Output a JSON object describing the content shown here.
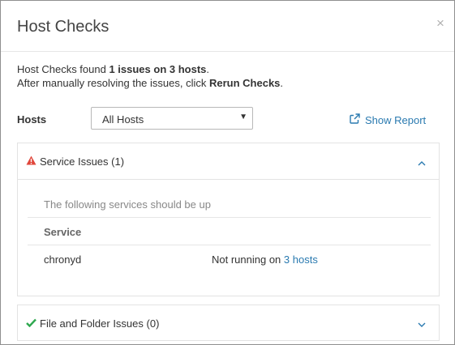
{
  "dialog": {
    "title": "Host Checks",
    "close_glyph": "×"
  },
  "summary": {
    "line1_prefix": "Host Checks found ",
    "line1_bold": "1 issues on 3 hosts",
    "line1_suffix": ".",
    "line2_prefix": "After manually resolving the issues, click ",
    "line2_bold": "Rerun Checks",
    "line2_suffix": "."
  },
  "hosts_filter": {
    "label": "Hosts",
    "selected": "All Hosts",
    "arrow_glyph": "▼"
  },
  "show_report": {
    "label": "Show Report",
    "icon": "external-link-icon",
    "color": "#2a7ab0"
  },
  "service_issues": {
    "title": "Service Issues (1)",
    "icon": "warning-icon",
    "icon_color": "#e0463b",
    "expanded": true,
    "intro": "The following services should be up",
    "column_header": "Service",
    "rows": [
      {
        "service": "chronyd",
        "status_prefix": "Not running on ",
        "status_link": "3 hosts"
      }
    ]
  },
  "file_folder_issues": {
    "title": "File and Folder Issues (0)",
    "icon": "checkmark-icon",
    "icon_color": "#2fa84f",
    "expanded": false
  },
  "colors": {
    "link": "#2a7ab0",
    "chevron": "#2a7ab0"
  }
}
